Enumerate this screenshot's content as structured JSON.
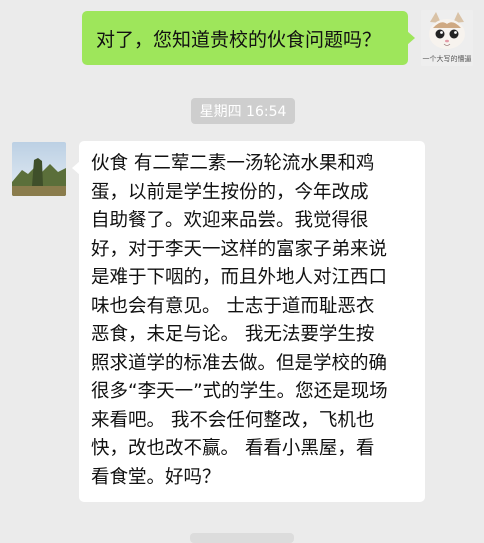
{
  "chat": {
    "outgoing": {
      "text": "对了，您知道贵校的伙食问题吗？",
      "avatar_caption": "一个大写的懵逼"
    },
    "timestamp": "星期四 16:54",
    "incoming": {
      "lines": [
        "伙食 有二荤二素一汤轮流水果和鸡",
        "蛋，以前是学生按份的，今年改成",
        "自助餐了。欢迎来品尝。我觉得很",
        "好，对于李天一这样的富家子弟来说",
        "是难于下咽的，而且外地人对江西口",
        "味也会有意见。 士志于道而耻恶衣",
        "恶食，未足与论。 我无法要学生按",
        "照求道学的标准去做。但是学校的确",
        "很多“李天一”式的学生。您还是现场",
        "来看吧。 我不会任何整改，飞机也",
        "快，改也改不赢。 看看小黑屋，看",
        "看食堂。好吗？"
      ]
    }
  },
  "colors": {
    "background": "#ebebeb",
    "outgoing_bubble": "#9ee65b",
    "incoming_bubble": "#ffffff",
    "timestamp_pill": "#cecece"
  }
}
